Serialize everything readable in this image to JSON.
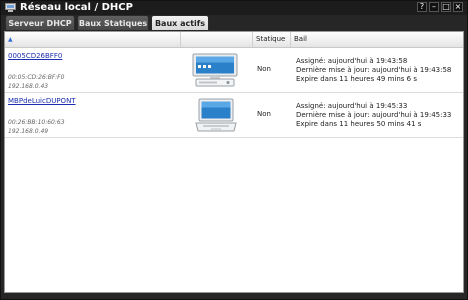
{
  "window": {
    "title": "Réseau local / DHCP",
    "controls": [
      "?",
      "–",
      "□",
      "×"
    ]
  },
  "tabs": [
    {
      "label": "Serveur DHCP",
      "active": false
    },
    {
      "label": "Baux Statiques",
      "active": false
    },
    {
      "label": "Baux actifs",
      "active": true
    }
  ],
  "table": {
    "columns": {
      "name": "",
      "device": "",
      "static": "Statique",
      "lease": "Bail"
    },
    "sort_column": "name",
    "sort_direction": "ascending",
    "rows": [
      {
        "name": "0005CD26BFF0",
        "mac": "00:05:CD:26:BF:F0",
        "ip": "192.168.0.43",
        "device_icon": "desktop-computer-icon",
        "static": "Non",
        "lease": [
          "Assigné: aujourd'hui à 19:43:58",
          "Dernière mise à jour: aujourd'hui à 19:43:58",
          "Expire dans 11 heures 49 mins 6 s"
        ]
      },
      {
        "name": "MBPdeLuicDUPONT",
        "mac": "00:26:BB:10:60:63",
        "ip": "192.168.0.49",
        "device_icon": "laptop-computer-icon",
        "static": "Non",
        "lease": [
          "Assigné: aujourd'hui à 19:45:33",
          "Dernière mise à jour: aujourd'hui à 19:45:33",
          "Expire dans 11 heures 50 mins 41 s"
        ]
      }
    ]
  },
  "colors": {
    "link": "#1b2fb0",
    "window_bg": "#262626",
    "active_tab": "#f2f2f2"
  }
}
